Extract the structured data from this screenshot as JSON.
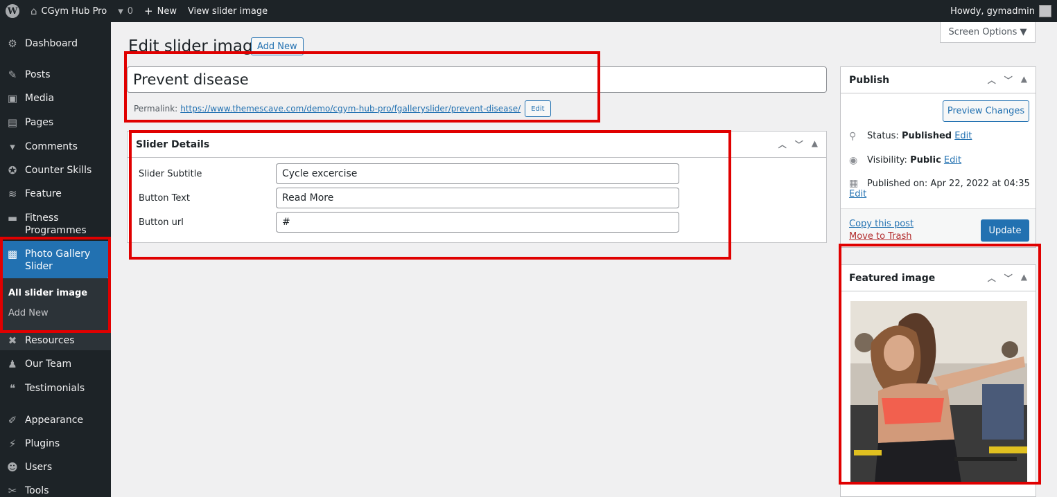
{
  "adminbar": {
    "site_name": "CGym Hub Pro",
    "comments_count": "0",
    "new_label": "New",
    "view_label": "View slider image",
    "howdy": "Howdy, gymadmin"
  },
  "sidebar": {
    "items": [
      {
        "label": "Dashboard",
        "icon": "dashboard-icon",
        "glyph": "⚙"
      },
      {
        "label": "Posts",
        "icon": "pin-icon",
        "glyph": "✎"
      },
      {
        "label": "Media",
        "icon": "media-icon",
        "glyph": "▣"
      },
      {
        "label": "Pages",
        "icon": "pages-icon",
        "glyph": "▤"
      },
      {
        "label": "Comments",
        "icon": "comments-icon",
        "glyph": "▾"
      },
      {
        "label": "Counter Skills",
        "icon": "counter-icon",
        "glyph": "✪"
      },
      {
        "label": "Feature",
        "icon": "feature-icon",
        "glyph": "≋"
      },
      {
        "label": "Fitness Programmes",
        "icon": "fitness-icon",
        "glyph": "▬"
      },
      {
        "label": "Photo Gallery Slider",
        "icon": "gallery-icon",
        "glyph": "▩"
      },
      {
        "label": "Resources",
        "icon": "resources-icon",
        "glyph": "✖"
      },
      {
        "label": "Our Team",
        "icon": "team-icon",
        "glyph": "♟"
      },
      {
        "label": "Testimonials",
        "icon": "quote-icon",
        "glyph": "❝"
      },
      {
        "label": "Appearance",
        "icon": "appearance-icon",
        "glyph": "✐"
      },
      {
        "label": "Plugins",
        "icon": "plugins-icon",
        "glyph": "⚡"
      },
      {
        "label": "Users",
        "icon": "users-icon",
        "glyph": "☻"
      },
      {
        "label": "Tools",
        "icon": "tools-icon",
        "glyph": "✂"
      }
    ],
    "submenu": {
      "all": "All slider image",
      "add_new": "Add New"
    }
  },
  "screen_options": "Screen Options ▼",
  "page": {
    "title": "Edit slider image",
    "add_new": "Add New",
    "post_title": "Prevent disease",
    "permalink_label": "Permalink:",
    "permalink_url": "https://www.themescave.com/demo/cgym-hub-pro/fgalleryslider/prevent-disease/",
    "permalink_edit": "Edit"
  },
  "slider_details": {
    "heading": "Slider Details",
    "fields": [
      {
        "label": "Slider Subtitle",
        "value": "Cycle excercise"
      },
      {
        "label": "Button Text",
        "value": "Read More"
      },
      {
        "label": "Button url",
        "value": "#"
      }
    ]
  },
  "publish": {
    "heading": "Publish",
    "preview": "Preview Changes",
    "status_label": "Status:",
    "status_value": "Published",
    "visibility_label": "Visibility:",
    "visibility_value": "Public",
    "published_on": "Published on: Apr 22, 2022 at 04:35",
    "edit": "Edit",
    "copy": "Copy this post",
    "trash": "Move to Trash",
    "update": "Update"
  },
  "featured": {
    "heading": "Featured image"
  },
  "colors": {
    "sidebar_bg": "#1d2327",
    "accent": "#2271b1",
    "highlight": "#e00000"
  }
}
